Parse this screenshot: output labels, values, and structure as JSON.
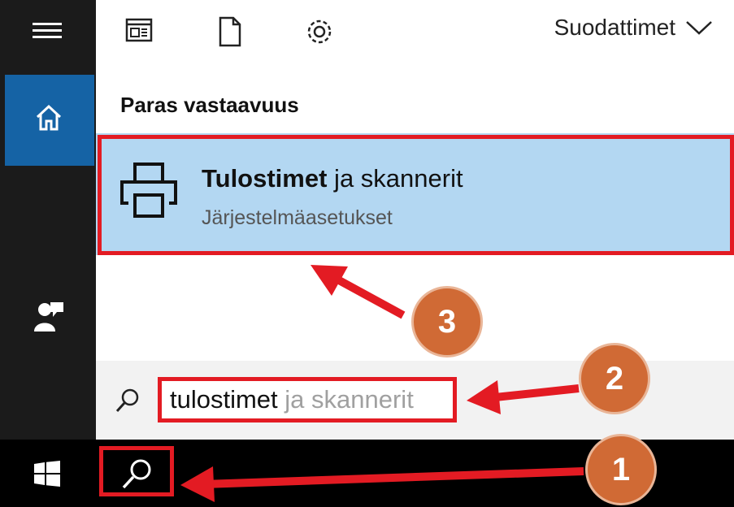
{
  "topbar": {
    "filters_label": "Suodattimet",
    "icons": [
      "news-icon",
      "document-icon",
      "settings-gear-icon",
      "chevron-down-icon"
    ]
  },
  "sidebar": {
    "icons": [
      "hamburger-menu-icon",
      "home-icon",
      "person-feedback-icon"
    ],
    "active": "home"
  },
  "results": {
    "section_title": "Paras vastaavuus",
    "best_match": {
      "title_bold": "Tulostimet",
      "title_rest": " ja skannerit",
      "subtitle": "Järjestelmäasetukset",
      "icon": "printer-icon"
    }
  },
  "search": {
    "typed": "tulostimet",
    "suggestion": " ja skannerit"
  },
  "taskbar": {
    "icons": [
      "windows-start-icon",
      "search-icon"
    ]
  },
  "annotations": {
    "badges": [
      "1",
      "2",
      "3"
    ],
    "arrow_color": "#e31b23",
    "badge_color": "#d06a35",
    "highlight_color": "#e31b23"
  }
}
